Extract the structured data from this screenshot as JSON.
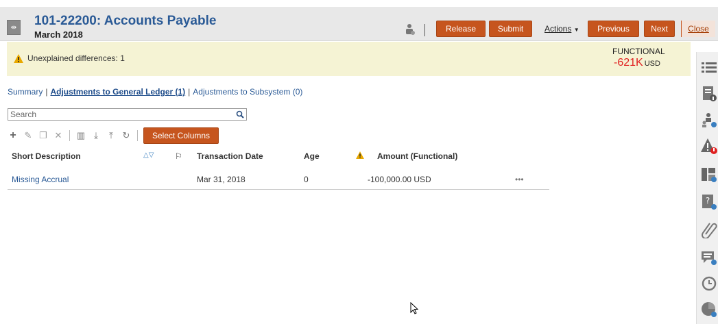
{
  "header": {
    "title": "101-22200: Accounts Payable",
    "period": "March 2018",
    "buttons": {
      "release": "Release",
      "submit": "Submit",
      "actions": "Actions",
      "previous": "Previous",
      "next": "Next",
      "close": "Close"
    }
  },
  "banner": {
    "warning_text": "Unexplained differences: 1",
    "functional_label": "FUNCTIONAL",
    "functional_value": "-621K",
    "functional_unit": "USD"
  },
  "tabs": {
    "summary": "Summary",
    "adjustments_gl": "Adjustments to General Ledger (1)",
    "adjustments_sub": "Adjustments to Subsystem (0)"
  },
  "search": {
    "placeholder": "Search"
  },
  "toolbar": {
    "select_columns": "Select Columns"
  },
  "grid": {
    "columns": {
      "short_description": "Short Description",
      "transaction_date": "Transaction Date",
      "age": "Age",
      "amount": "Amount (Functional)"
    },
    "rows": [
      {
        "short_description": "Missing Accrual",
        "transaction_date": "Mar 31, 2018",
        "age": "0",
        "amount": "-100,000.00 USD",
        "more": "•••"
      }
    ]
  },
  "colors": {
    "accent_button": "#c6551e",
    "link": "#2a5a96",
    "negative": "#e02020",
    "banner_bg": "#f5f3d4"
  }
}
